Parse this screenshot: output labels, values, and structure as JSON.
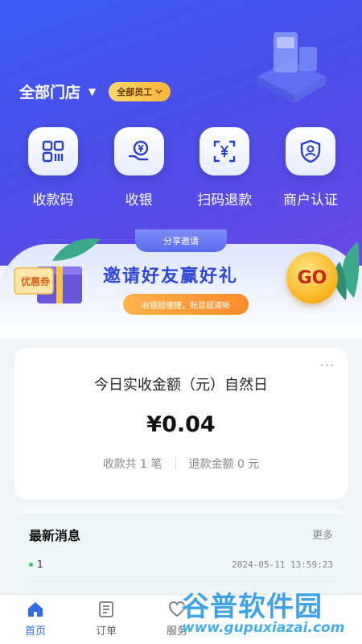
{
  "header": {
    "store_label": "全部门店",
    "staff_filter": "全部员工"
  },
  "actions": [
    {
      "label": "收款码",
      "icon": "qr-grid-icon"
    },
    {
      "label": "收银",
      "icon": "yen-hand-icon"
    },
    {
      "label": "扫码退款",
      "icon": "scan-yen-icon"
    },
    {
      "label": "商户认证",
      "icon": "shield-check-icon"
    }
  ],
  "banner": {
    "tab": "分享邀请",
    "title": "邀请好友赢好礼",
    "subtitle": "收银超便捷，账目超清晰",
    "coupon": "优惠券",
    "go": "GO"
  },
  "revenue_card": {
    "title": "今日实收金额（元）自然日",
    "amount": "¥0.04",
    "count_text": "收款共 1 笔",
    "refund_text": "退款金额 0 元",
    "more": "···"
  },
  "messages": {
    "title": "最新消息",
    "more": "更多",
    "items": [
      {
        "text": "1",
        "time": "2024-05-11 13:59:23"
      }
    ]
  },
  "tabbar": {
    "items": [
      {
        "label": "首页",
        "active": true
      },
      {
        "label": "订单",
        "active": false
      },
      {
        "label": "服务",
        "active": false
      }
    ]
  },
  "watermark": {
    "title": "谷普软件园",
    "url": "www.gupuxiazai.com"
  },
  "colors": {
    "hero": "#4a4fe8",
    "accent": "#2f6ce6",
    "gold": "#f8b43a"
  }
}
